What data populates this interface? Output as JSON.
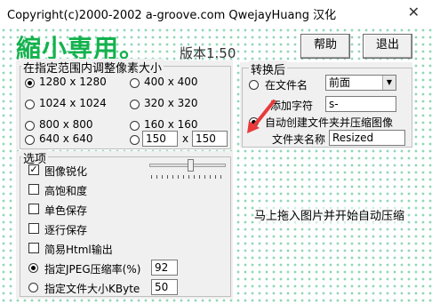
{
  "window": {
    "title": "Copyright(c)2000-2002 a-groove.com QwejayHuang 汉化",
    "close_glyph": "✕"
  },
  "brand": {
    "title": "縮小専用。",
    "version": "版本1.50"
  },
  "buttons": {
    "help": "帮助",
    "exit": "退出"
  },
  "resize": {
    "title": "在指定范围内调整像素大小",
    "options": [
      {
        "label": "1280 x 1280",
        "selected": true
      },
      {
        "label": "400 x 400",
        "selected": false
      },
      {
        "label": "1024 x 1024",
        "selected": false
      },
      {
        "label": "320 x 320",
        "selected": false
      },
      {
        "label": "800 x 800",
        "selected": false
      },
      {
        "label": "160 x 160",
        "selected": false
      },
      {
        "label": "640 x 640",
        "selected": false
      }
    ],
    "custom_width": "150",
    "custom_sep": "x",
    "custom_height": "150"
  },
  "options": {
    "title": "选项",
    "sharpen": "图像锐化",
    "saturation": "高饱和度",
    "mono": "单色保存",
    "progressive": "逐行保存",
    "html": "简易Html输出",
    "jpeg_label": "指定JPEG压缩率(%)",
    "jpeg_value": "92",
    "size_label": "指定文件大小KByte",
    "size_value": "50"
  },
  "convert": {
    "title": "转换后",
    "filename_label": "在文件名",
    "position_value": "前面",
    "add_char_label": "添加字符",
    "add_char_value": "s-",
    "autofolder_label": "自动创建文件夹并压缩图像",
    "folder_label": "文件夹名称",
    "folder_value": "Resized"
  },
  "drop_hint": "马上拖入图片并开始自动压缩",
  "colors": {
    "brand": "#13b24d",
    "dots": "#8fd6b7",
    "arrow": "#e83a3a"
  }
}
